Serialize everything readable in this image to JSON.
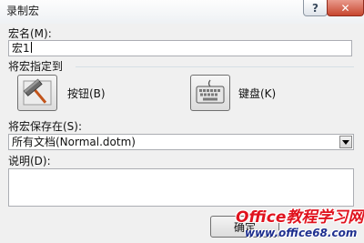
{
  "window": {
    "title": "录制宏",
    "help_label": "?",
    "close_label": "✕"
  },
  "macro_name": {
    "label": "宏名(M):",
    "value": "宏1"
  },
  "assign_group": {
    "label": "将宏指定到",
    "button_label": "按钮(B)",
    "keyboard_label": "键盘(K)",
    "button_icon": "hammer-icon",
    "keyboard_icon": "keyboard-icon"
  },
  "store_in": {
    "label": "将宏保存在(S):",
    "selected": "所有文档(Normal.dotm)"
  },
  "description": {
    "label": "说明(D):",
    "value": ""
  },
  "buttons": {
    "ok_label": "确定"
  },
  "watermark": {
    "brand": "Office教程学习网",
    "url": "www.office68.com"
  },
  "colors": {
    "close_button": "#c7472f",
    "watermark_red": "#e0131e",
    "watermark_blue": "#1e2f8f"
  }
}
